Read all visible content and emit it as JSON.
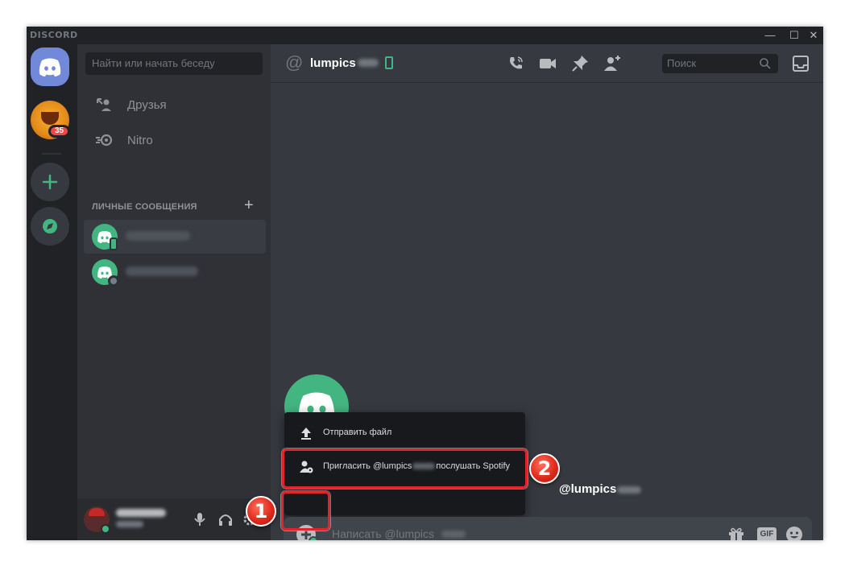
{
  "window": {
    "brand": "DISCORD",
    "controls": {
      "minimize": "—",
      "maximize": "☐",
      "close": "✕"
    }
  },
  "rail": {
    "mention_badge": "35"
  },
  "dm_sidebar": {
    "search_placeholder": "Найти или начать беседу",
    "nav": [
      {
        "label": "Друзья",
        "icon": "friends-icon"
      },
      {
        "label": "Nitro",
        "icon": "nitro-icon"
      }
    ],
    "section_header": "ЛИЧНЫЕ СООБЩЕНИЯ",
    "add_dm": "+"
  },
  "chat": {
    "header": {
      "channel_name": "lumpics",
      "search_placeholder": "Поиск"
    },
    "welcome_name": "@lumpics",
    "popout": {
      "items": [
        {
          "label": "Отправить файл",
          "icon": "upload-icon"
        },
        {
          "label_prefix": "Пригласить @lumpics",
          "label_suffix": "послушать Spotify",
          "icon": "invite-spotify-icon"
        }
      ]
    },
    "composer": {
      "placeholder": "Написать @lumpics",
      "gif_label": "GIF"
    }
  },
  "annotations": {
    "step1": "1",
    "step2": "2",
    "highlight_color": "#e3222b"
  },
  "colors": {
    "blurple": "#7289da",
    "green": "#43b581",
    "bg_chat": "#36393f",
    "bg_sidebar": "#2f3136",
    "bg_rail": "#202225"
  }
}
